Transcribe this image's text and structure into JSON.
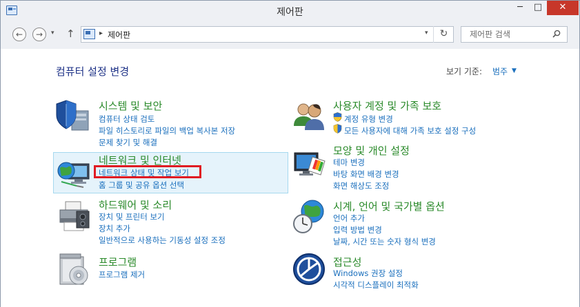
{
  "window": {
    "title": "제어판",
    "minimize_label": "─",
    "maximize_label": "□",
    "close_label": "✕"
  },
  "nav": {
    "back_label": "←",
    "forward_label": "→",
    "recent_label": "▾",
    "up_label": "↑",
    "address_sep": "▸",
    "address_text": "제어판",
    "address_drop": "▾",
    "refresh_label": "↻",
    "search_placeholder": "제어판 검색"
  },
  "header": {
    "title": "컴퓨터 설정 변경",
    "view_by_label": "보기 기준:",
    "view_by_value": "범주",
    "view_by_arrow": "▼"
  },
  "categories": [
    {
      "title": "시스템 및 보안",
      "icon": "system-security-icon",
      "links": [
        "컴퓨터 상태 검토",
        "파일 히스토리로 파일의 백업 복사본 저장",
        "문제 찾기 및 해결"
      ]
    },
    {
      "title": "네트워크 및 인터넷",
      "icon": "network-internet-icon",
      "links": [
        "네트워크 상태 및 작업 보기",
        "홈 그룹 및 공유 옵션 선택"
      ]
    },
    {
      "title": "하드웨어 및 소리",
      "icon": "hardware-sound-icon",
      "links": [
        "장치 및 프린터 보기",
        "장치 추가",
        "일반적으로 사용하는 기동성 설정 조정"
      ]
    },
    {
      "title": "프로그램",
      "icon": "programs-icon",
      "links": [
        "프로그램 제거"
      ]
    },
    {
      "title": "사용자 계정 및 가족 보호",
      "icon": "user-accounts-icon",
      "links": [
        "계정 유형 변경",
        "모든 사용자에 대해 가족 보호 설정 구성"
      ]
    },
    {
      "title": "모양 및 개인 설정",
      "icon": "appearance-icon",
      "links": [
        "테마 변경",
        "바탕 화면 배경 변경",
        "화면 해상도 조정"
      ]
    },
    {
      "title": "시계, 언어 및 국가별 옵션",
      "icon": "clock-language-icon",
      "links": [
        "언어 추가",
        "입력 방법 변경",
        "날짜, 시간 또는 숫자 형식 변경"
      ]
    },
    {
      "title": "접근성",
      "icon": "ease-of-access-icon",
      "links": [
        "Windows 권장 설정",
        "시각적 디스플레이 최적화"
      ]
    }
  ],
  "colors": {
    "category_title": "#2a8a2a",
    "link": "#1a6fbd",
    "page_title": "#1e3287",
    "close_button": "#c7372a",
    "hover_highlight": "#e5f3fb",
    "selection_outline": "#e01b22"
  }
}
